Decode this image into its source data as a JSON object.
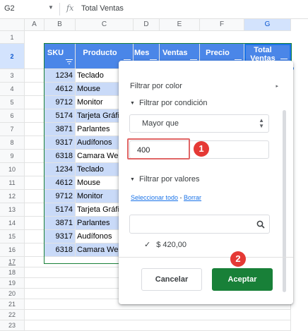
{
  "formula_bar": {
    "cell_ref": "G2",
    "fx": "fx",
    "content": "Total Ventas"
  },
  "columns": [
    "A",
    "B",
    "C",
    "D",
    "E",
    "F",
    "G"
  ],
  "rows": [
    "1",
    "2",
    "3",
    "4",
    "5",
    "6",
    "7",
    "8",
    "9",
    "10",
    "11",
    "12",
    "13",
    "14",
    "15",
    "16",
    "17",
    "18",
    "19",
    "20",
    "21",
    "22",
    "23"
  ],
  "headers": {
    "sku": "SKU",
    "producto": "Producto",
    "mes": "Mes",
    "ventas": "Ventas",
    "precio": "Precio",
    "total": "Total Ventas"
  },
  "data_rows": [
    {
      "sku": "1234",
      "producto": "Teclado"
    },
    {
      "sku": "4612",
      "producto": "Mouse"
    },
    {
      "sku": "9712",
      "producto": "Monitor"
    },
    {
      "sku": "5174",
      "producto": "Tarjeta Gráfi"
    },
    {
      "sku": "3871",
      "producto": "Parlantes"
    },
    {
      "sku": "9317",
      "producto": "Audífonos"
    },
    {
      "sku": "6318",
      "producto": "Camara Web"
    },
    {
      "sku": "1234",
      "producto": "Teclado"
    },
    {
      "sku": "4612",
      "producto": "Mouse"
    },
    {
      "sku": "9712",
      "producto": "Monitor"
    },
    {
      "sku": "5174",
      "producto": "Tarjeta Gráfi"
    },
    {
      "sku": "3871",
      "producto": "Parlantes"
    },
    {
      "sku": "9317",
      "producto": "Audífonos"
    },
    {
      "sku": "6318",
      "producto": "Camara Web"
    }
  ],
  "filter_panel": {
    "filter_by_color": "Filtrar por color",
    "filter_by_condition": "Filtrar por condición",
    "condition_selected": "Mayor que",
    "condition_value": "400",
    "filter_by_values": "Filtrar por valores",
    "select_all": "Seleccionar todo",
    "link_separator": " - ",
    "clear": "Borrar",
    "value_items": [
      {
        "label": "$ 420,00",
        "checked": true
      }
    ],
    "cancel": "Cancelar",
    "accept": "Aceptar"
  },
  "annotations": {
    "badge1": "1",
    "badge2": "2"
  },
  "colors": {
    "header_blue": "#4a86e8",
    "light_blue": "#c9daf8",
    "accept_green": "#188038",
    "badge_red": "#e53935"
  },
  "icons": [
    "chevron-down-icon",
    "fx-icon",
    "filter-icon",
    "chevron-right-icon",
    "triangle-down-icon",
    "search-icon",
    "check-icon"
  ]
}
